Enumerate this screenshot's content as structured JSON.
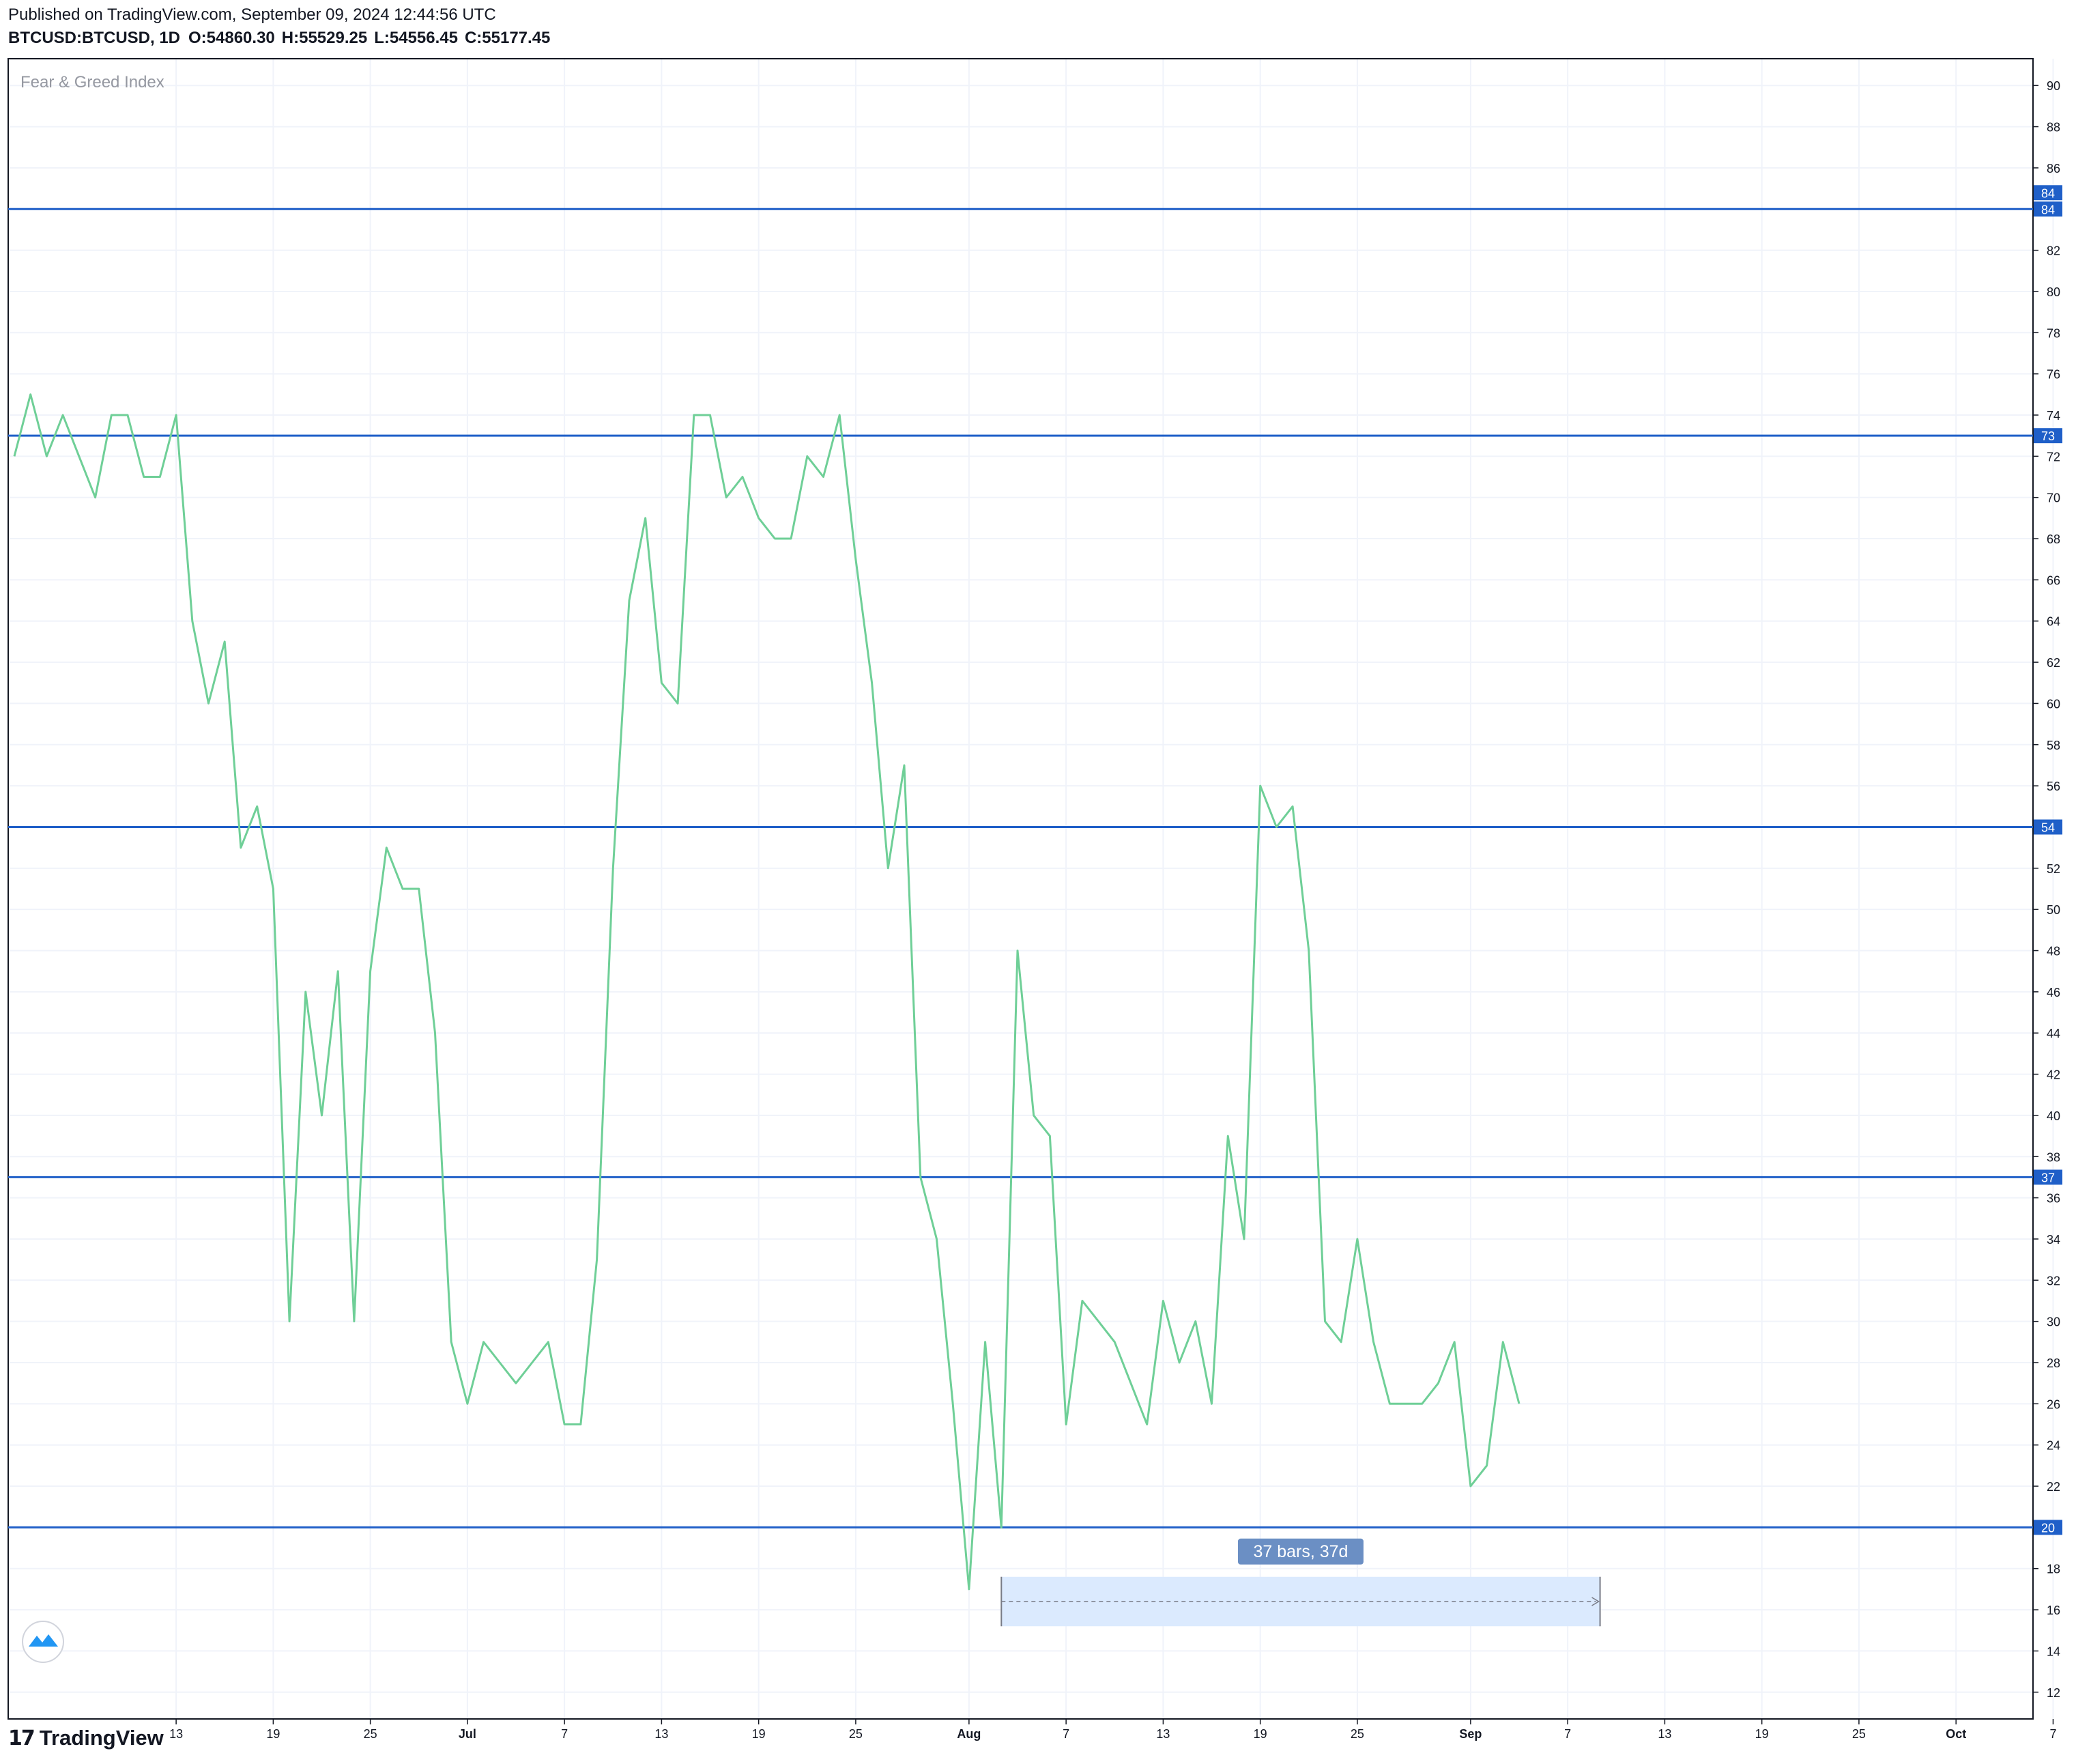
{
  "header": {
    "published": "Published on TradingView.com, September 09, 2024 12:44:56 UTC",
    "symbol": "BTCUSD:BTCUSD, 1D",
    "open": "O:54860.30",
    "high": "H:55529.25",
    "low": "L:54556.45",
    "close": "C:55177.45"
  },
  "brand": {
    "name": "TradingView",
    "mark": "17"
  },
  "colors": {
    "series": "#6fcf97",
    "levels": "#1f5fc8",
    "measure_fill": "#dbeafe",
    "measure_label_bg": "#6b8fc4"
  },
  "chart_data": {
    "type": "line",
    "title": "Fear & Greed Index",
    "x_start": "2024-06-03",
    "values": [
      72,
      75,
      72,
      74,
      72,
      70,
      74,
      74,
      71,
      71,
      74,
      64,
      60,
      63,
      53,
      55,
      51,
      30,
      46,
      40,
      47,
      30,
      47,
      53,
      51,
      51,
      44,
      29,
      26,
      29,
      28,
      27,
      28,
      29,
      25,
      25,
      33,
      52,
      65,
      69,
      61,
      60,
      74,
      74,
      70,
      71,
      69,
      68,
      68,
      72,
      71,
      74,
      67,
      61,
      52,
      57,
      37,
      34,
      26,
      17,
      29,
      20,
      48,
      40,
      39,
      25,
      31,
      30,
      29,
      27,
      25,
      31,
      28,
      30,
      26,
      39,
      34,
      56,
      54,
      55,
      48,
      30,
      29,
      34,
      29,
      26,
      26,
      26,
      27,
      29,
      22,
      23,
      29,
      26
    ],
    "y_ticks": [
      12,
      14,
      16,
      18,
      20,
      22,
      24,
      26,
      28,
      30,
      32,
      34,
      36,
      38,
      40,
      42,
      44,
      46,
      48,
      50,
      52,
      54,
      56,
      58,
      60,
      62,
      64,
      66,
      68,
      70,
      72,
      74,
      76,
      78,
      80,
      82,
      84,
      86,
      88,
      90
    ],
    "ylim": [
      10.7,
      91.3
    ],
    "x_ticks": [
      {
        "label": "13",
        "date": "2024-06-13"
      },
      {
        "label": "19",
        "date": "2024-06-19"
      },
      {
        "label": "25",
        "date": "2024-06-25"
      },
      {
        "label": "Jul",
        "date": "2024-07-01"
      },
      {
        "label": "7",
        "date": "2024-07-07"
      },
      {
        "label": "13",
        "date": "2024-07-13"
      },
      {
        "label": "19",
        "date": "2024-07-19"
      },
      {
        "label": "25",
        "date": "2024-07-25"
      },
      {
        "label": "Aug",
        "date": "2024-08-01"
      },
      {
        "label": "7",
        "date": "2024-08-07"
      },
      {
        "label": "13",
        "date": "2024-08-13"
      },
      {
        "label": "19",
        "date": "2024-08-19"
      },
      {
        "label": "25",
        "date": "2024-08-25"
      },
      {
        "label": "Sep",
        "date": "2024-09-01"
      },
      {
        "label": "7",
        "date": "2024-09-07"
      },
      {
        "label": "13",
        "date": "2024-09-13"
      },
      {
        "label": "19",
        "date": "2024-09-19"
      },
      {
        "label": "25",
        "date": "2024-09-25"
      },
      {
        "label": "Oct",
        "date": "2024-10-01"
      },
      {
        "label": "7",
        "date": "2024-10-07"
      }
    ],
    "horizontal_levels": [
      84,
      73,
      54,
      37,
      20
    ],
    "axis_labels": [
      84,
      84,
      73,
      54,
      37,
      20
    ],
    "measure": {
      "label": "37 bars, 37d",
      "x_from": "2024-08-03",
      "x_to": "2024-09-09",
      "y_from": 15.2,
      "y_to": 17.6
    },
    "grid": true
  }
}
